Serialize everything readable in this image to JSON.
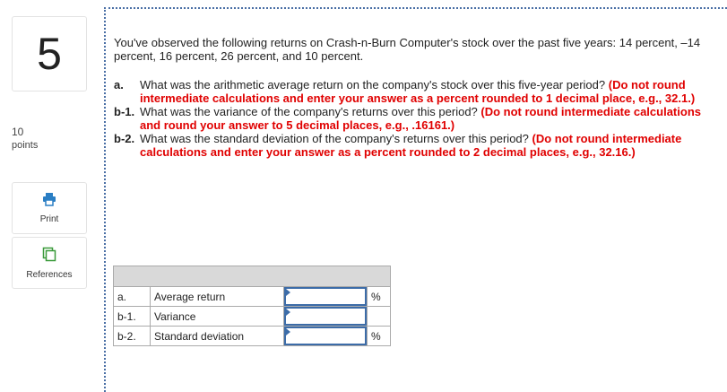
{
  "question": {
    "number": "5",
    "points_value": "10",
    "points_label": "points"
  },
  "tools": {
    "print_label": "Print",
    "references_label": "References"
  },
  "problem": {
    "intro": "You've observed the following returns on Crash-n-Burn Computer's stock over the past five years: 14 percent, –14 percent, 16 percent, 26 percent, and 10 percent.",
    "parts": [
      {
        "label": "a.",
        "text": "What was the arithmetic average return on the company's stock over this five-year period?",
        "instruction": "(Do not round intermediate calculations and enter your answer as a percent rounded to 1 decimal place, e.g., 32.1.)"
      },
      {
        "label": "b-1.",
        "text": "What was the variance of the company's returns over this period?",
        "instruction": "(Do not round intermediate calculations and round your answer to 5 decimal places, e.g., .16161.)"
      },
      {
        "label": "b-2.",
        "text": "What was the standard deviation of the company's returns over this period?",
        "instruction": "(Do not round intermediate calculations and enter your answer as a percent rounded to 2 decimal places, e.g., 32.16.)"
      }
    ]
  },
  "answer_table": {
    "rows": [
      {
        "label": "a.",
        "description": "Average return",
        "value": "",
        "unit": "%"
      },
      {
        "label": "b-1.",
        "description": "Variance",
        "value": "",
        "unit": ""
      },
      {
        "label": "b-2.",
        "description": "Standard deviation",
        "value": "",
        "unit": "%"
      }
    ]
  },
  "colors": {
    "instruction_red": "#e00000",
    "input_border": "#3c6ca8",
    "divider": "#4a6fa5"
  }
}
